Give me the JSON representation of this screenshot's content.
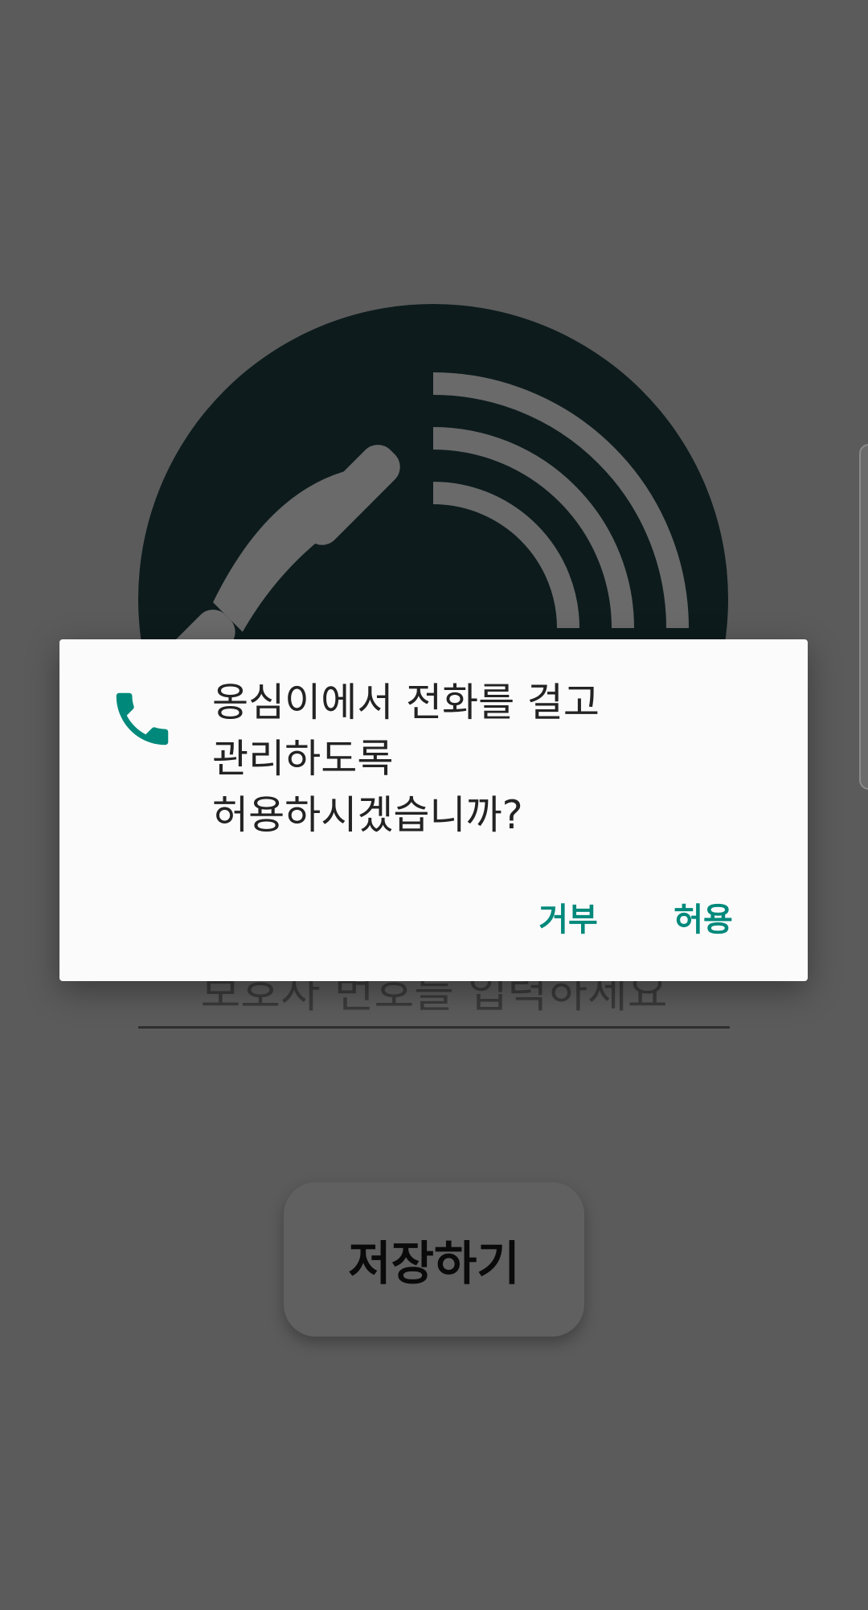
{
  "app": {
    "guardian_input": {
      "placeholder": "보호자 번호를 입력하세요",
      "value": ""
    },
    "save_label": "저장하기",
    "logo_icon": "phone-call-waves-icon"
  },
  "permission_dialog": {
    "icon": "phone-icon",
    "message_lines": [
      "옹심이에서 전화를 걸고",
      "관리하도록",
      "허용하시겠습니까?"
    ],
    "deny_label": "거부",
    "allow_label": "허용",
    "accent_color": "#00897B"
  },
  "colors": {
    "scrim": "#5B5B5B",
    "logo_background": "#0D1B1C",
    "dialog_background": "#FBFBFB"
  }
}
